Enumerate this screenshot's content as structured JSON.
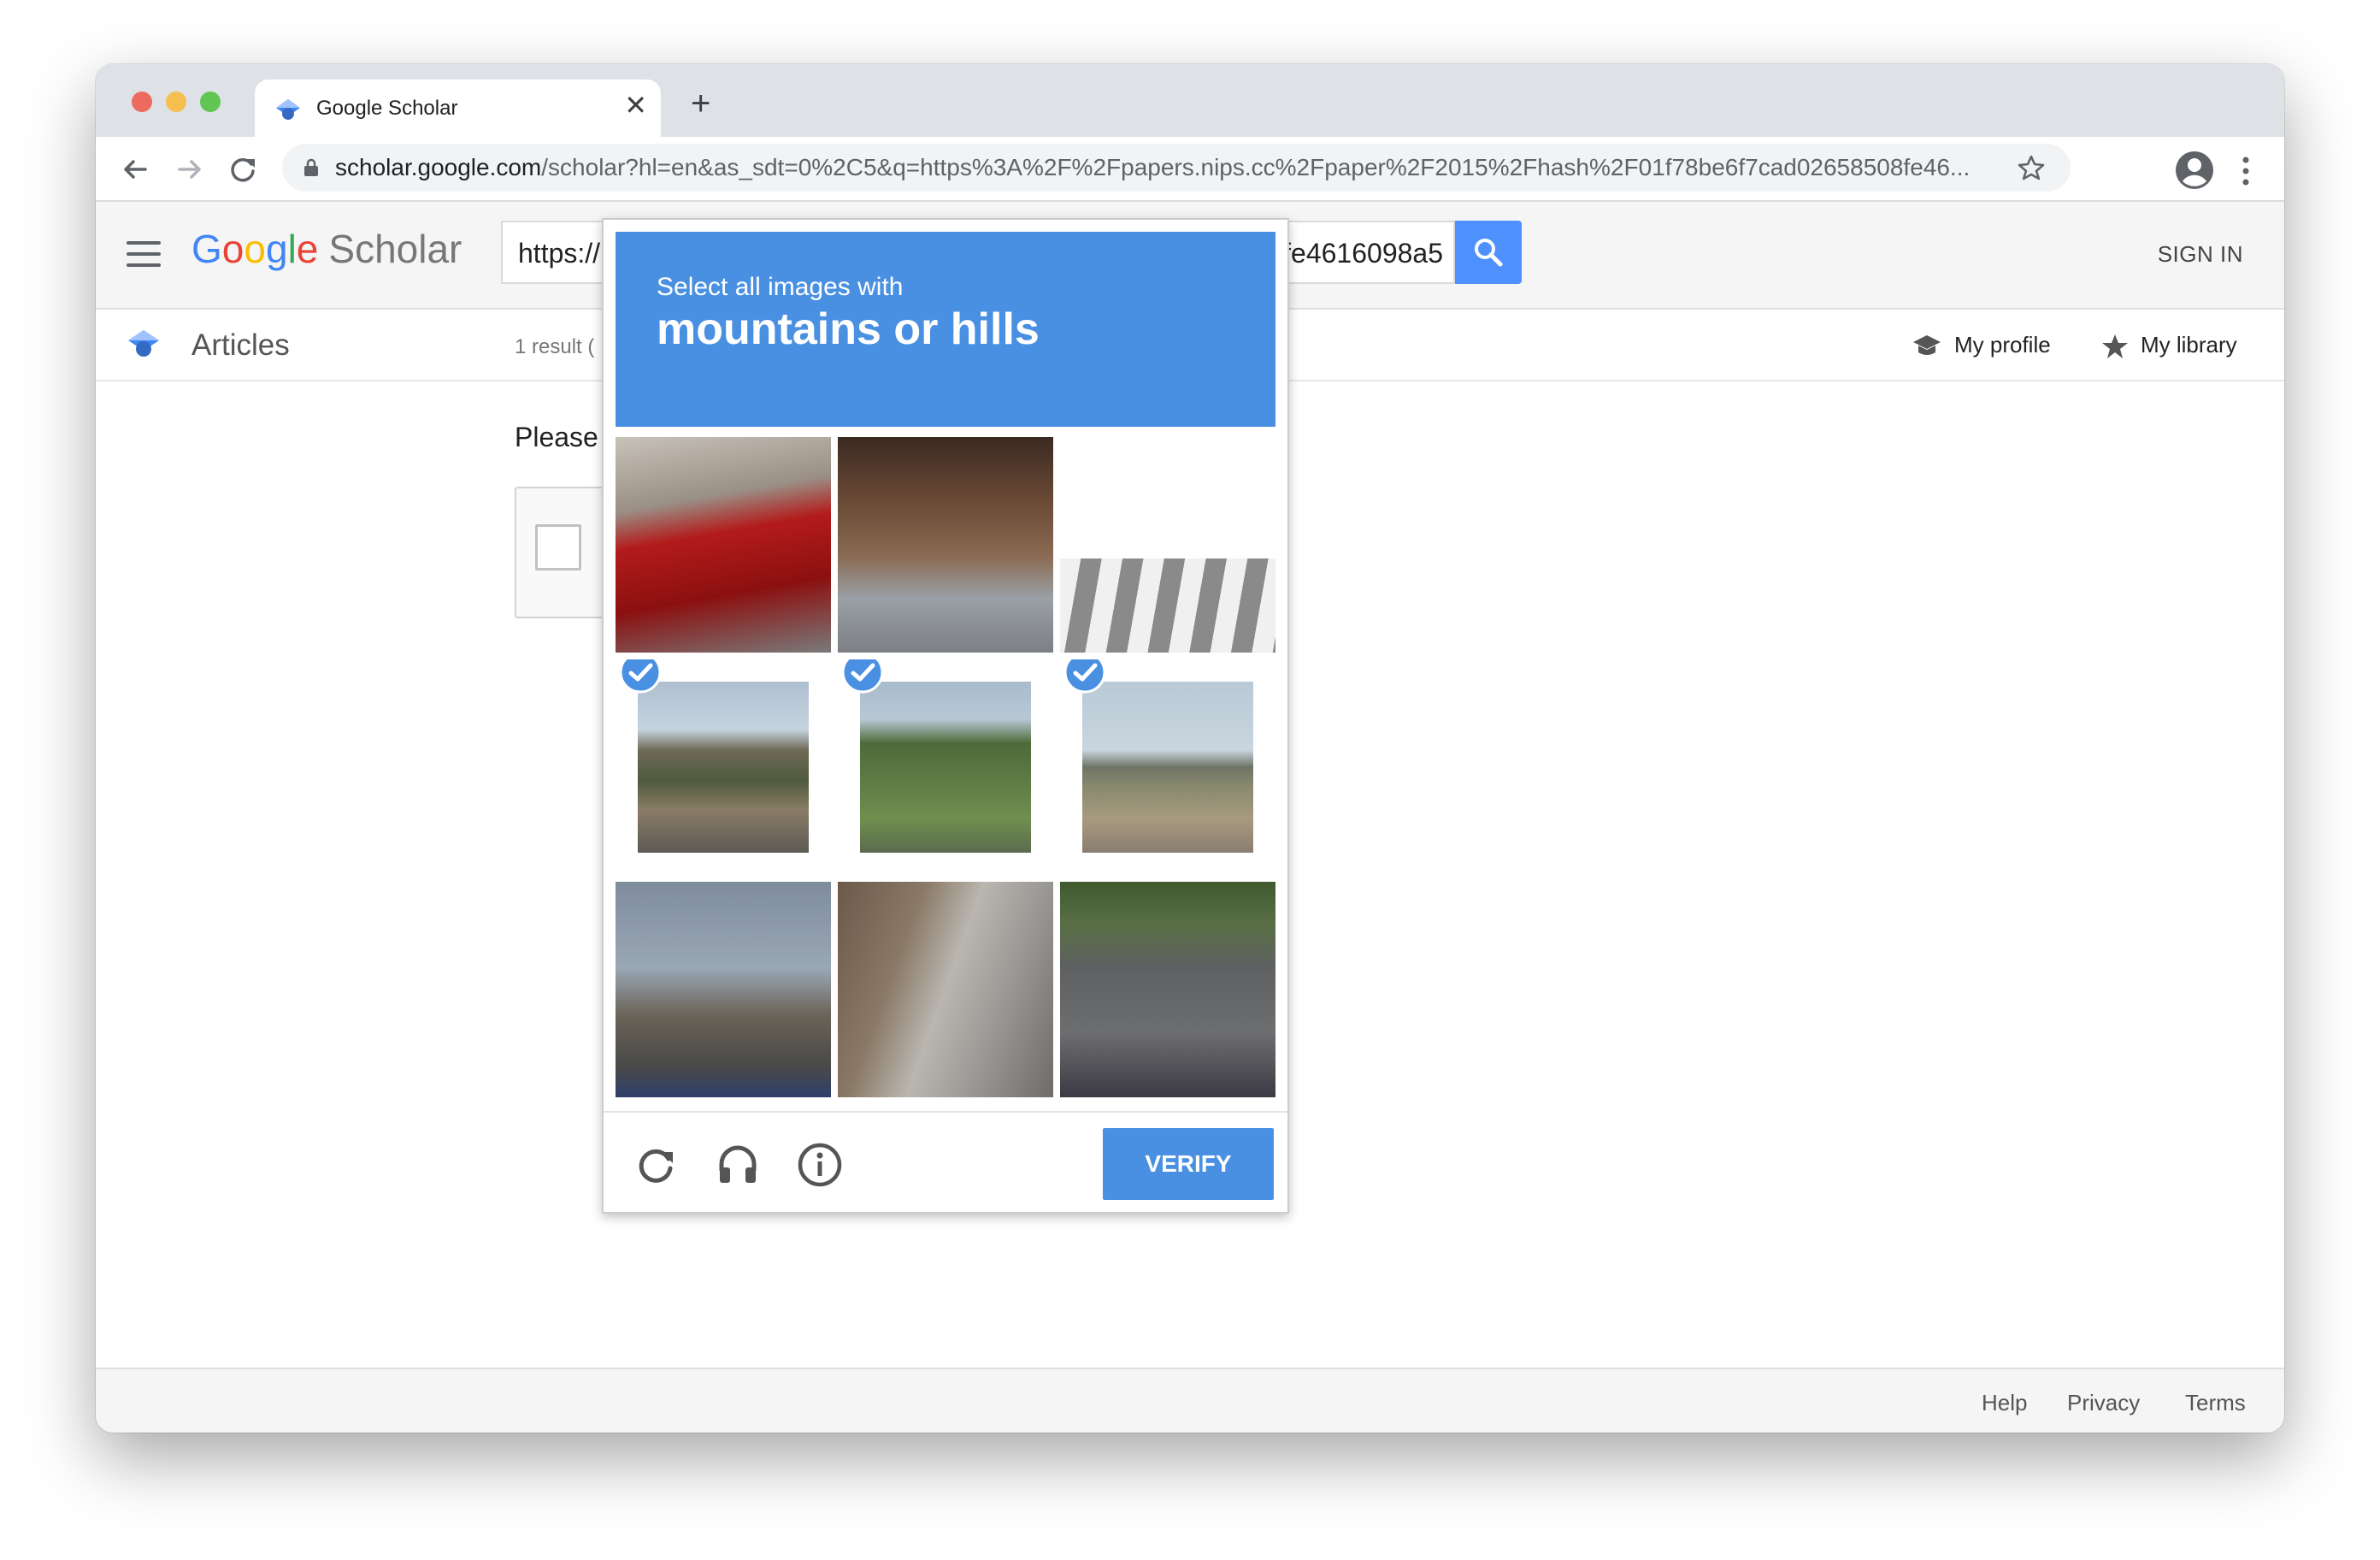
{
  "browser": {
    "tab_title": "Google Scholar",
    "tab_close": "✕",
    "new_tab": "+",
    "url_host": "scholar.google.com",
    "url_path": "/scholar?hl=en&as_sdt=0%2C5&q=https%3A%2F%2Fpapers.nips.cc%2Fpaper%2F2015%2Fhash%2F01f78be6f7cad02658508fe46..."
  },
  "header": {
    "logo_google": [
      "G",
      "o",
      "o",
      "g",
      "l",
      "e"
    ],
    "logo_scholar": "Scholar",
    "search_value_start": "https://p",
    "search_value_end": "3fe4616098a5",
    "sign_in": "SIGN IN"
  },
  "subheader": {
    "articles": "Articles",
    "result_count": "1 result (",
    "my_profile": "My profile",
    "my_library": "My library"
  },
  "body": {
    "please_text": "Please"
  },
  "captcha": {
    "instruction": "Select all images with",
    "target": "mountains or hills",
    "verify_label": "VERIFY",
    "selected_tiles": [
      3,
      4,
      5
    ]
  },
  "footer": {
    "help": "Help",
    "privacy": "Privacy",
    "terms": "Terms"
  },
  "colors": {
    "captcha_blue": "#4a90e2",
    "search_button": "#4d90fe"
  }
}
